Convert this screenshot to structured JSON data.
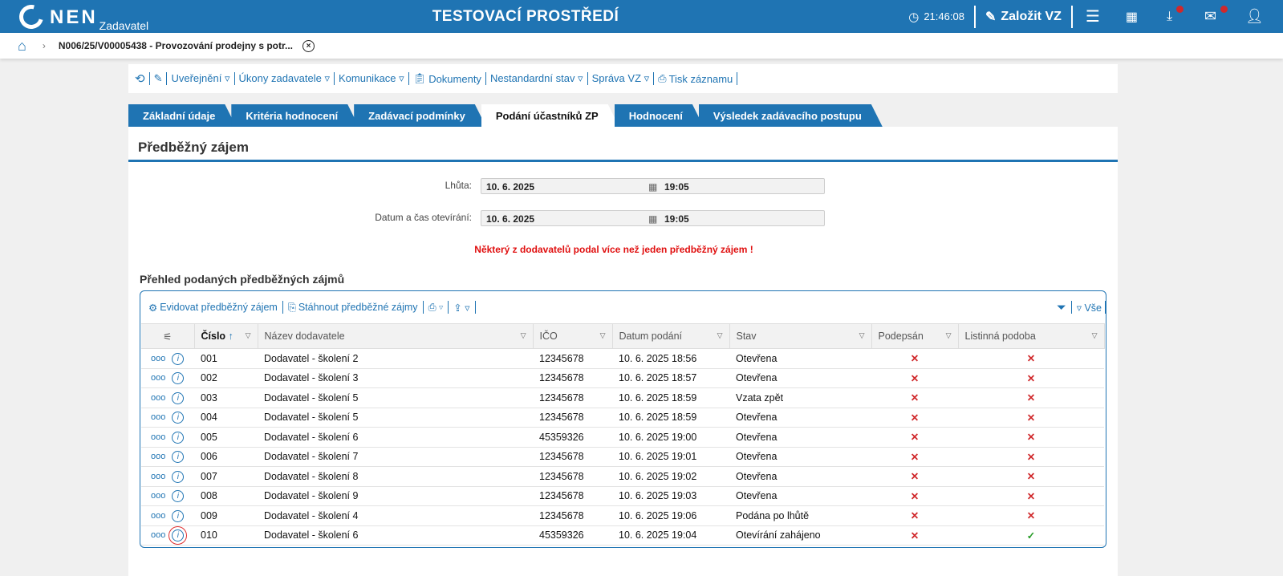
{
  "header": {
    "logo": "NEN",
    "logo_sub": "Zadavatel",
    "title": "TESTOVACÍ PROSTŘEDÍ",
    "time": "21:46:08",
    "create_label": "Založit VZ"
  },
  "breadcrumb": {
    "item": "N006/25/V00005438 - Provozování prodejny s potr..."
  },
  "toolbar": {
    "items": [
      "Uveřejnění ▿",
      "Úkony zadavatele ▿",
      "Komunikace ▿",
      "Dokumenty",
      "Nestandardní stav ▿",
      "Správa VZ ▿",
      "Tisk záznamu"
    ]
  },
  "tabs": [
    "Základní údaje",
    "Kritéria hodnocení",
    "Zadávací podmínky",
    "Podání účastníků ZP",
    "Hodnocení",
    "Výsledek zadávacího postupu"
  ],
  "section": {
    "title": "Předběžný zájem",
    "deadline_label": "Lhůta:",
    "deadline_date": "10. 6. 2025",
    "deadline_time": "19:05",
    "opening_label": "Datum a čas otevírání:",
    "opening_date": "10. 6. 2025",
    "opening_time": "19:05",
    "warning": "Některý z dodavatelů podal více než jeden předběžný zájem !"
  },
  "grid": {
    "title": "Přehled podaných předběžných zájmů",
    "register_label": "Evidovat předběžný zájem",
    "download_label": "Stáhnout předběžné zájmy",
    "filter_all": "Vše",
    "columns": [
      "Číslo",
      "Název dodavatele",
      "IČO",
      "Datum podání",
      "Stav",
      "Podepsán",
      "Listinná podoba"
    ],
    "rows": [
      {
        "no": "001",
        "name": "Dodavatel - školení 2",
        "ico": "12345678",
        "date": "10. 6. 2025 18:56",
        "state": "Otevřena",
        "signed": "✕",
        "paper": "✕"
      },
      {
        "no": "002",
        "name": "Dodavatel - školení 3",
        "ico": "12345678",
        "date": "10. 6. 2025 18:57",
        "state": "Otevřena",
        "signed": "✕",
        "paper": "✕"
      },
      {
        "no": "003",
        "name": "Dodavatel - školení 5",
        "ico": "12345678",
        "date": "10. 6. 2025 18:59",
        "state": "Vzata zpět",
        "signed": "✕",
        "paper": "✕"
      },
      {
        "no": "004",
        "name": "Dodavatel - školení 5",
        "ico": "12345678",
        "date": "10. 6. 2025 18:59",
        "state": "Otevřena",
        "signed": "✕",
        "paper": "✕"
      },
      {
        "no": "005",
        "name": "Dodavatel - školení 6",
        "ico": "45359326",
        "date": "10. 6. 2025 19:00",
        "state": "Otevřena",
        "signed": "✕",
        "paper": "✕"
      },
      {
        "no": "006",
        "name": "Dodavatel - školení 7",
        "ico": "12345678",
        "date": "10. 6. 2025 19:01",
        "state": "Otevřena",
        "signed": "✕",
        "paper": "✕"
      },
      {
        "no": "007",
        "name": "Dodavatel - školení 8",
        "ico": "12345678",
        "date": "10. 6. 2025 19:02",
        "state": "Otevřena",
        "signed": "✕",
        "paper": "✕"
      },
      {
        "no": "008",
        "name": "Dodavatel - školení 9",
        "ico": "12345678",
        "date": "10. 6. 2025 19:03",
        "state": "Otevřena",
        "signed": "✕",
        "paper": "✕"
      },
      {
        "no": "009",
        "name": "Dodavatel - školení 4",
        "ico": "12345678",
        "date": "10. 6. 2025 19:06",
        "state": "Podána po lhůtě",
        "signed": "✕",
        "paper": "✕"
      },
      {
        "no": "010",
        "name": "Dodavatel - školení 6",
        "ico": "45359326",
        "date": "10. 6. 2025 19:04",
        "state": "Otevírání zahájeno",
        "signed": "✕",
        "paper": "✓"
      }
    ]
  }
}
